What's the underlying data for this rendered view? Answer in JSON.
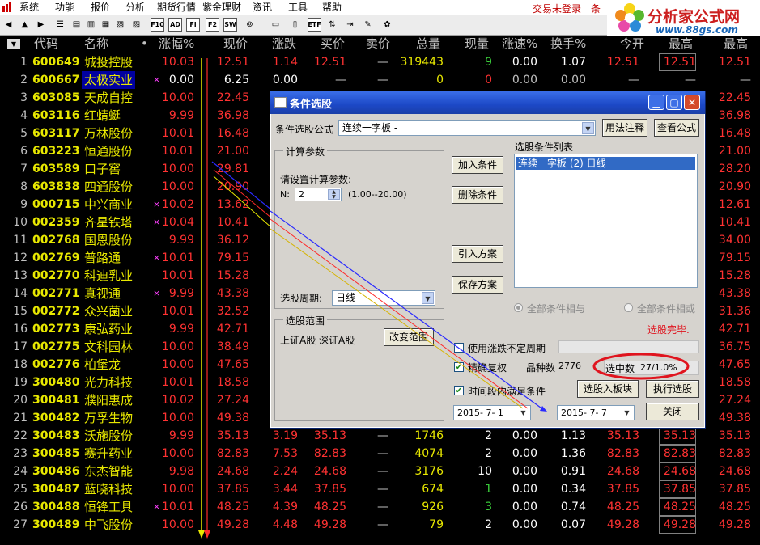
{
  "menu": {
    "items": [
      "系统",
      "功能",
      "报价",
      "分析",
      "期货行情",
      "紫金理财",
      "资讯",
      "工具",
      "帮助"
    ],
    "trade_status": "交易未登录",
    "trade_extra": "条"
  },
  "toolbar": {
    "icons": [
      "back-arrow-icon",
      "up-arrow-icon",
      "forward-arrow-icon",
      "quote-list-icon",
      "chart-icon",
      "bars-icon",
      "grid-icon",
      "list-icon",
      "table-icon",
      "f10-icon",
      "ad-icon",
      "fi-icon",
      "f2-icon",
      "sw-icon",
      "settings-icon",
      "folder-icon",
      "doc-icon",
      "etf-icon",
      "sort-icon",
      "import-icon",
      "arrow-icon",
      "open-icon",
      "pin-icon"
    ],
    "labels": {
      "f10": "F10",
      "ad": "AD",
      "fi": "Fi",
      "f2": "F2",
      "sw": "SW",
      "etf": "ETF"
    }
  },
  "brand": {
    "name": "分析家公式网",
    "url": "www.88gs.com"
  },
  "grid": {
    "headers": {
      "code": "代码",
      "name": "名称",
      "dot": "•",
      "change_pct": "涨幅%",
      "price": "现价",
      "diff": "涨跌",
      "bid": "买价",
      "ask": "卖价",
      "volume": "总量",
      "cur_vol": "现量",
      "speed": "涨速%",
      "turnover": "换手%",
      "open": "今开",
      "high": "最高",
      "high2": "最高"
    },
    "rows": [
      {
        "i": "1",
        "code": "600649",
        "name": "城投控股",
        "mark": "",
        "chg": "10.03",
        "price": "12.51",
        "diff": "1.14",
        "bid": "12.51",
        "ask": "—",
        "vol": "319443",
        "cur": "9",
        "spd": "0.00",
        "turn": "1.07",
        "open": "12.51",
        "high": "12.51",
        "hi2": "12.51"
      },
      {
        "i": "2",
        "code": "600667",
        "name": "太极实业",
        "mark": "×",
        "chg": "0.00",
        "price": "6.25",
        "diff": "0.00",
        "bid": "—",
        "ask": "—",
        "vol": "0",
        "cur": "0",
        "spd": "0.00",
        "turn": "0.00",
        "open": "—",
        "high": "—",
        "hi2": "—"
      },
      {
        "i": "3",
        "code": "603085",
        "name": "天成自控",
        "mark": "",
        "chg": "10.00",
        "price": "22.45",
        "diff": "",
        "bid": "",
        "ask": "",
        "vol": "",
        "cur": "",
        "spd": "",
        "turn": "",
        "open": "",
        "high": "",
        "hi2": "22.45"
      },
      {
        "i": "4",
        "code": "603116",
        "name": "红蜻蜓",
        "mark": "",
        "chg": "9.99",
        "price": "36.98",
        "diff": "",
        "bid": "",
        "ask": "",
        "vol": "",
        "cur": "",
        "spd": "",
        "turn": "",
        "open": "",
        "high": "",
        "hi2": "36.98"
      },
      {
        "i": "5",
        "code": "603117",
        "name": "万林股份",
        "mark": "",
        "chg": "10.01",
        "price": "16.48",
        "diff": "",
        "bid": "",
        "ask": "",
        "vol": "",
        "cur": "",
        "spd": "",
        "turn": "",
        "open": "",
        "high": "",
        "hi2": "16.48"
      },
      {
        "i": "6",
        "code": "603223",
        "name": "恒通股份",
        "mark": "",
        "chg": "10.01",
        "price": "21.00",
        "diff": "",
        "bid": "",
        "ask": "",
        "vol": "",
        "cur": "",
        "spd": "",
        "turn": "",
        "open": "",
        "high": "",
        "hi2": "21.00"
      },
      {
        "i": "7",
        "code": "603589",
        "name": "口子窖",
        "mark": "",
        "chg": "10.00",
        "price": "29.81",
        "diff": "",
        "bid": "",
        "ask": "",
        "vol": "",
        "cur": "",
        "spd": "",
        "turn": "",
        "open": "",
        "high": "",
        "hi2": "28.20"
      },
      {
        "i": "8",
        "code": "603838",
        "name": "四通股份",
        "mark": "",
        "chg": "10.00",
        "price": "20.90",
        "diff": "",
        "bid": "",
        "ask": "",
        "vol": "",
        "cur": "",
        "spd": "",
        "turn": "",
        "open": "",
        "high": "",
        "hi2": "20.90"
      },
      {
        "i": "9",
        "code": "000715",
        "name": "中兴商业",
        "mark": "×",
        "chg": "10.02",
        "price": "13.62",
        "diff": "",
        "bid": "",
        "ask": "",
        "vol": "",
        "cur": "",
        "spd": "",
        "turn": "",
        "open": "",
        "high": "",
        "hi2": "12.61"
      },
      {
        "i": "10",
        "code": "002359",
        "name": "齐星铁塔",
        "mark": "×",
        "chg": "10.04",
        "price": "10.41",
        "diff": "",
        "bid": "",
        "ask": "",
        "vol": "",
        "cur": "",
        "spd": "",
        "turn": "",
        "open": "",
        "high": "",
        "hi2": "10.41"
      },
      {
        "i": "11",
        "code": "002768",
        "name": "国恩股份",
        "mark": "",
        "chg": "9.99",
        "price": "36.12",
        "diff": "",
        "bid": "",
        "ask": "",
        "vol": "",
        "cur": "",
        "spd": "",
        "turn": "",
        "open": "",
        "high": "",
        "hi2": "34.00"
      },
      {
        "i": "12",
        "code": "002769",
        "name": "普路通",
        "mark": "×",
        "chg": "10.01",
        "price": "79.15",
        "diff": "",
        "bid": "",
        "ask": "",
        "vol": "",
        "cur": "",
        "spd": "",
        "turn": "",
        "open": "",
        "high": "",
        "hi2": "79.15"
      },
      {
        "i": "13",
        "code": "002770",
        "name": "科迪乳业",
        "mark": "",
        "chg": "10.01",
        "price": "15.28",
        "diff": "",
        "bid": "",
        "ask": "",
        "vol": "",
        "cur": "",
        "spd": "",
        "turn": "",
        "open": "",
        "high": "",
        "hi2": "15.28"
      },
      {
        "i": "14",
        "code": "002771",
        "name": "真视通",
        "mark": "×",
        "chg": "9.99",
        "price": "43.38",
        "diff": "",
        "bid": "",
        "ask": "",
        "vol": "",
        "cur": "",
        "spd": "",
        "turn": "",
        "open": "",
        "high": "",
        "hi2": "43.38"
      },
      {
        "i": "15",
        "code": "002772",
        "name": "众兴菌业",
        "mark": "",
        "chg": "10.01",
        "price": "32.52",
        "diff": "",
        "bid": "",
        "ask": "",
        "vol": "",
        "cur": "",
        "spd": "",
        "turn": "",
        "open": "",
        "high": "",
        "hi2": "31.36"
      },
      {
        "i": "16",
        "code": "002773",
        "name": "康弘药业",
        "mark": "",
        "chg": "9.99",
        "price": "42.71",
        "diff": "",
        "bid": "",
        "ask": "",
        "vol": "",
        "cur": "",
        "spd": "",
        "turn": "",
        "open": "",
        "high": "",
        "hi2": "42.71"
      },
      {
        "i": "17",
        "code": "002775",
        "name": "文科园林",
        "mark": "",
        "chg": "10.00",
        "price": "38.49",
        "diff": "",
        "bid": "",
        "ask": "",
        "vol": "",
        "cur": "",
        "spd": "",
        "turn": "",
        "open": "",
        "high": "",
        "hi2": "36.75"
      },
      {
        "i": "18",
        "code": "002776",
        "name": "柏堡龙",
        "mark": "",
        "chg": "10.00",
        "price": "47.65",
        "diff": "",
        "bid": "",
        "ask": "",
        "vol": "",
        "cur": "",
        "spd": "",
        "turn": "",
        "open": "",
        "high": "",
        "hi2": "47.65"
      },
      {
        "i": "19",
        "code": "300480",
        "name": "光力科技",
        "mark": "",
        "chg": "10.01",
        "price": "18.58",
        "diff": "",
        "bid": "",
        "ask": "",
        "vol": "",
        "cur": "",
        "spd": "",
        "turn": "",
        "open": "",
        "high": "",
        "hi2": "18.58"
      },
      {
        "i": "20",
        "code": "300481",
        "name": "濮阳惠成",
        "mark": "",
        "chg": "10.02",
        "price": "27.24",
        "diff": "",
        "bid": "",
        "ask": "",
        "vol": "",
        "cur": "",
        "spd": "",
        "turn": "",
        "open": "",
        "high": "",
        "hi2": "27.24"
      },
      {
        "i": "21",
        "code": "300482",
        "name": "万孚生物",
        "mark": "",
        "chg": "10.00",
        "price": "49.38",
        "diff": "",
        "bid": "",
        "ask": "",
        "vol": "",
        "cur": "",
        "spd": "",
        "turn": "",
        "open": "",
        "high": "",
        "hi2": "49.38"
      },
      {
        "i": "22",
        "code": "300483",
        "name": "沃施股份",
        "mark": "",
        "chg": "9.99",
        "price": "35.13",
        "diff": "3.19",
        "bid": "35.13",
        "ask": "—",
        "vol": "1746",
        "cur": "2",
        "spd": "0.00",
        "turn": "1.13",
        "open": "35.13",
        "high": "35.13",
        "hi2": "35.13"
      },
      {
        "i": "23",
        "code": "300485",
        "name": "赛升药业",
        "mark": "",
        "chg": "10.00",
        "price": "82.83",
        "diff": "7.53",
        "bid": "82.83",
        "ask": "—",
        "vol": "4074",
        "cur": "2",
        "spd": "0.00",
        "turn": "1.36",
        "open": "82.83",
        "high": "82.83",
        "hi2": "82.83"
      },
      {
        "i": "24",
        "code": "300486",
        "name": "东杰智能",
        "mark": "",
        "chg": "9.98",
        "price": "24.68",
        "diff": "2.24",
        "bid": "24.68",
        "ask": "—",
        "vol": "3176",
        "cur": "10",
        "spd": "0.00",
        "turn": "0.91",
        "open": "24.68",
        "high": "24.68",
        "hi2": "24.68"
      },
      {
        "i": "25",
        "code": "300487",
        "name": "蓝晓科技",
        "mark": "",
        "chg": "10.00",
        "price": "37.85",
        "diff": "3.44",
        "bid": "37.85",
        "ask": "—",
        "vol": "674",
        "cur": "1",
        "spd": "0.00",
        "turn": "0.34",
        "open": "37.85",
        "high": "37.85",
        "hi2": "37.85"
      },
      {
        "i": "26",
        "code": "300488",
        "name": "恒锋工具",
        "mark": "×",
        "chg": "10.01",
        "price": "48.25",
        "diff": "4.39",
        "bid": "48.25",
        "ask": "—",
        "vol": "926",
        "cur": "3",
        "spd": "0.00",
        "turn": "0.74",
        "open": "48.25",
        "high": "48.25",
        "hi2": "48.25"
      },
      {
        "i": "27",
        "code": "300489",
        "name": "中飞股份",
        "mark": "",
        "chg": "10.00",
        "price": "49.28",
        "diff": "4.48",
        "bid": "49.28",
        "ask": "—",
        "vol": "79",
        "cur": "2",
        "spd": "0.00",
        "turn": "0.07",
        "open": "49.28",
        "high": "49.28",
        "hi2": "49.28"
      }
    ]
  },
  "dialog": {
    "title": "条件选股",
    "formula_label": "条件选股公式",
    "formula_value": "连续一字板 -",
    "usage_btn": "用法注释",
    "view_btn": "查看公式",
    "calc_group": "计算参数",
    "calc_prompt": "请设置计算参数:",
    "param_name": "N:",
    "param_value": "2",
    "param_range": "(1.00--20.00)",
    "period_label": "选股周期:",
    "period_value": "日线",
    "add_btn": "加入条件",
    "del_btn": "删除条件",
    "import_btn": "引入方案",
    "save_btn": "保存方案",
    "list_label": "选股条件列表",
    "list_item": "连续一字板 (2) 日线",
    "radio_and": "全部条件相与",
    "radio_or": "全部条件相或",
    "scope_group": "选股范围",
    "scope_value": "上证A股 深证A股",
    "scope_btn": "改变范围",
    "done_text": "选股完毕.",
    "chk_unfixed": "使用涨跌不定周期",
    "chk_restore": "精确复权",
    "chk_time": "时间段内满足条件",
    "count_label": "品种数",
    "count_value": "2776",
    "selected_label": "选中数",
    "selected_value": "27/1.0%",
    "to_block_btn": "选股入板块",
    "run_btn": "执行选股",
    "close_btn": "关闭",
    "date_from": "2015- 7- 1",
    "date_to": "2015- 7- 7",
    "highlight_color": "#e0141e"
  }
}
